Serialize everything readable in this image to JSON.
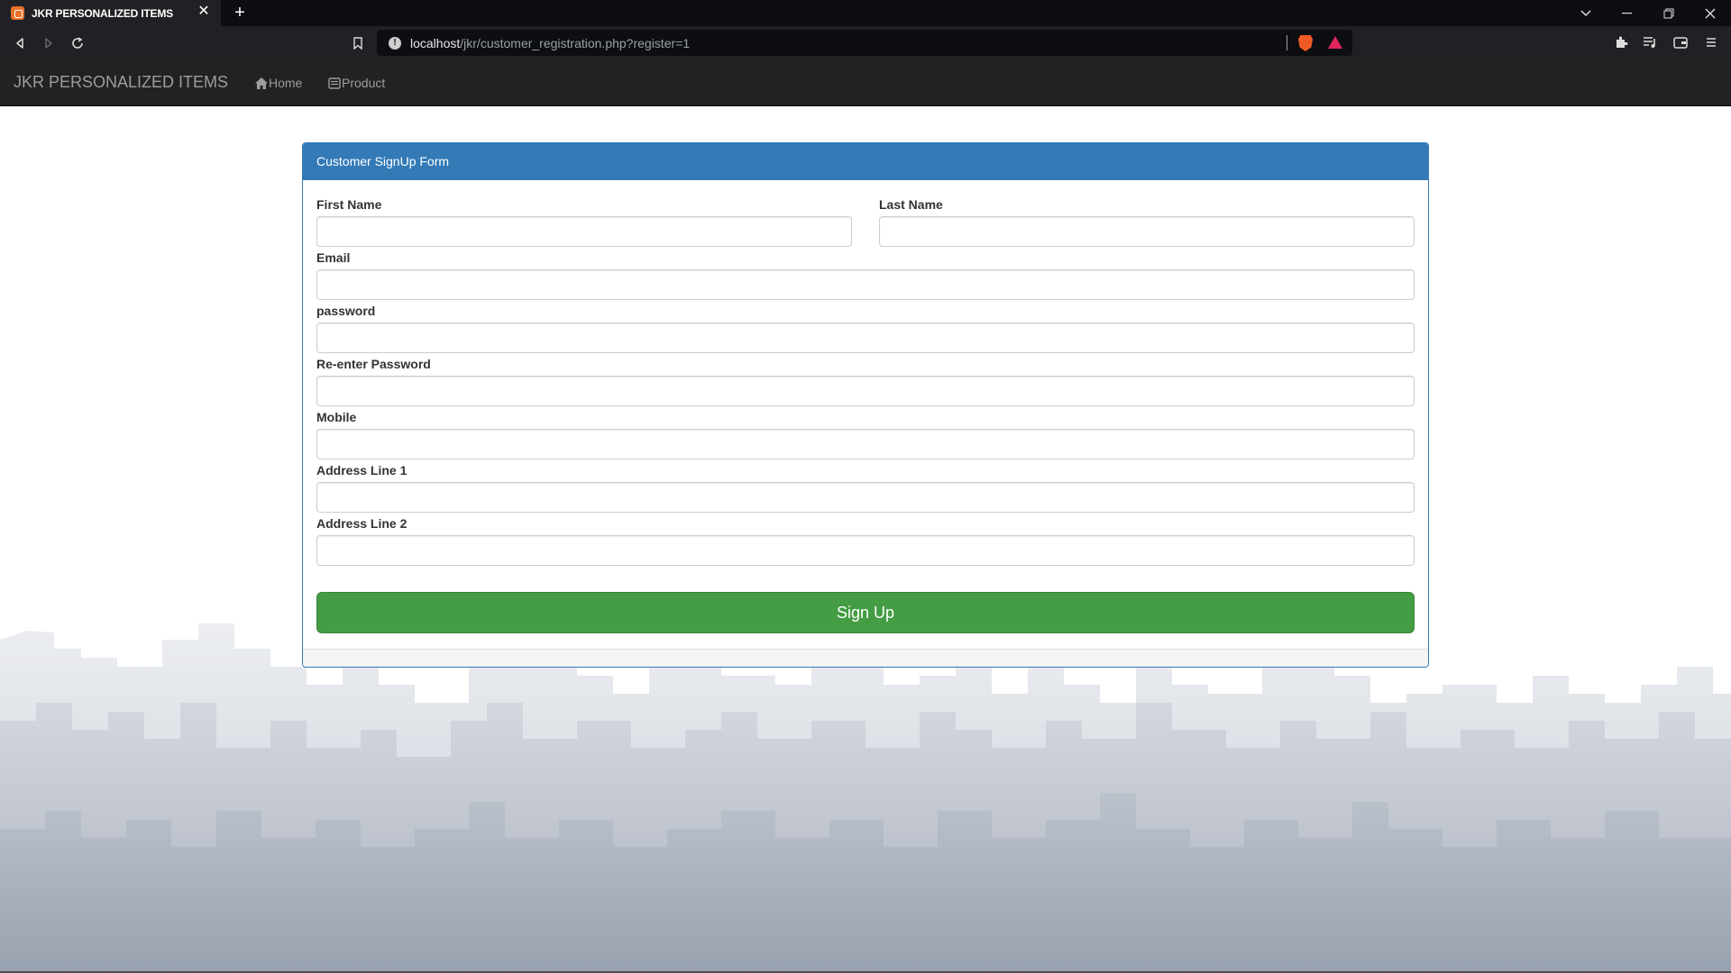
{
  "browser": {
    "tab_title": "JKR PERSONALIZED ITEMS",
    "url_host": "localhost",
    "url_path": "/jkr/customer_registration.php?register=1"
  },
  "navbar": {
    "brand": "JKR PERSONALIZED ITEMS",
    "links": [
      {
        "label": "Home",
        "icon": "home-icon"
      },
      {
        "label": "Product",
        "icon": "product-icon"
      }
    ]
  },
  "form": {
    "heading": "Customer SignUp Form",
    "first_name_label": "First Name",
    "last_name_label": "Last Name",
    "email_label": "Email",
    "password_label": "password",
    "reenter_password_label": "Re-enter Password",
    "mobile_label": "Mobile",
    "address1_label": "Address Line 1",
    "address2_label": "Address Line 2",
    "submit_label": "Sign Up"
  },
  "colors": {
    "panel_primary": "#337ab7",
    "button_success": "#449d44",
    "navbar_bg": "#222222"
  }
}
